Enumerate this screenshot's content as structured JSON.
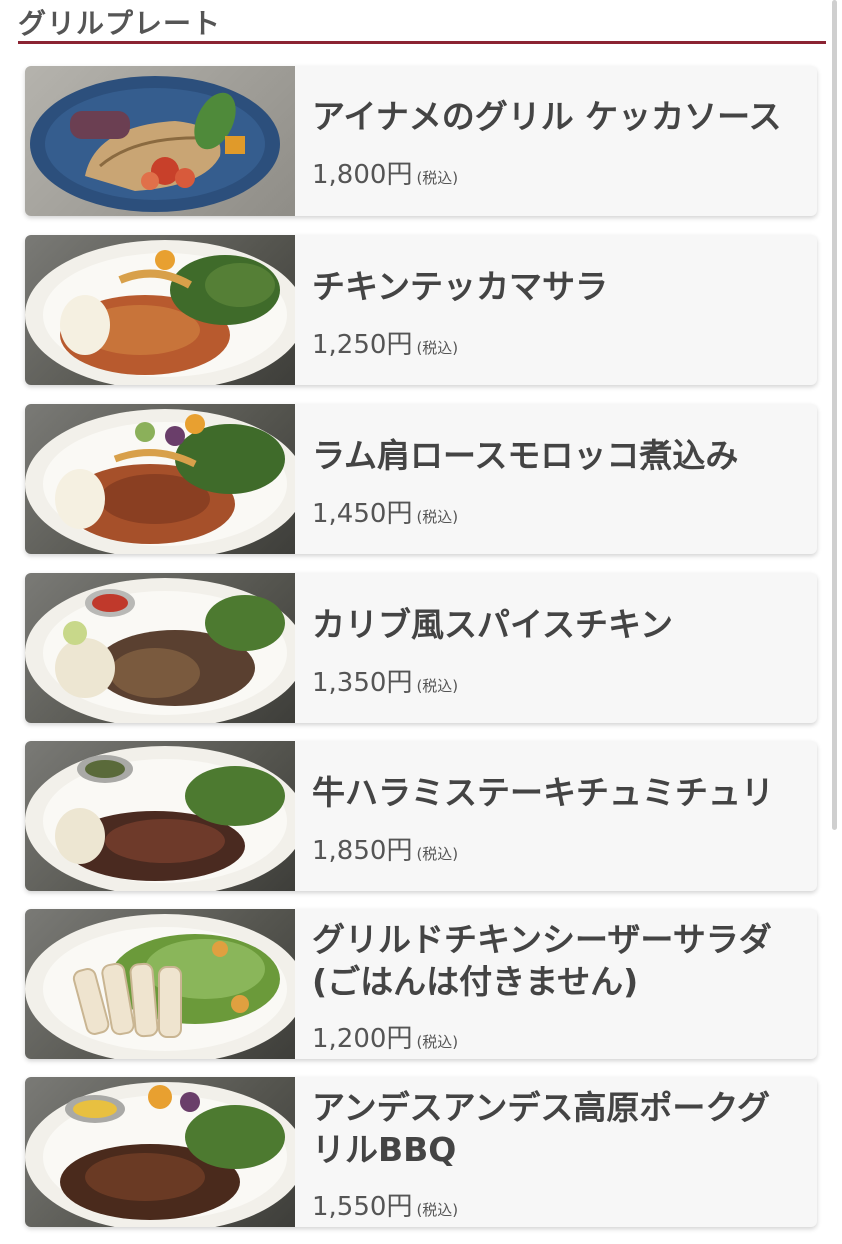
{
  "section": {
    "title": "グリルプレート"
  },
  "tax_label": "(税込)",
  "items": [
    {
      "name": "アイナメのグリル ケッカソース",
      "price": "1,800",
      "currency": "円",
      "icon": "grilled-fish-plate-photo"
    },
    {
      "name": "チキンテッカマサラ",
      "price": "1,250",
      "currency": "円",
      "icon": "chicken-tikka-masala-photo"
    },
    {
      "name": "ラム肩ロースモロッコ煮込み",
      "price": "1,450",
      "currency": "円",
      "icon": "lamb-stew-photo"
    },
    {
      "name": "カリブ風スパイスチキン",
      "price": "1,350",
      "currency": "円",
      "icon": "spiced-chicken-photo"
    },
    {
      "name": "牛ハラミステーキチュミチュリ",
      "price": "1,850",
      "currency": "円",
      "icon": "skirt-steak-photo"
    },
    {
      "name": "グリルドチキンシーザーサラダ",
      "name_line2": "(ごはんは付きません)",
      "price": "1,200",
      "currency": "円",
      "icon": "caesar-salad-photo"
    },
    {
      "name": "アンデスアンデス高原ポークグ",
      "name_line2": "リルBBQ",
      "price": "1,550",
      "currency": "円",
      "icon": "pork-bbq-photo"
    }
  ]
}
